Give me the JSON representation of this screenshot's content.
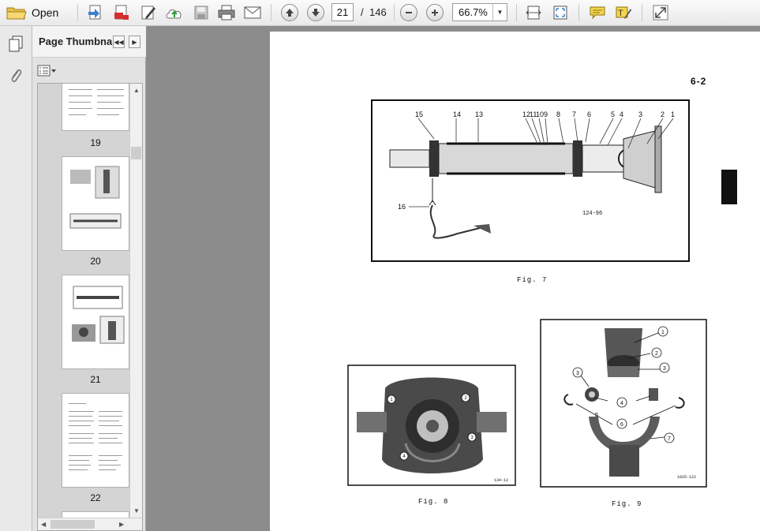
{
  "toolbar": {
    "open_label": "Open",
    "current_page": "21",
    "page_separator": "/",
    "total_pages": "146",
    "zoom_value": "66.7%"
  },
  "thumbnails_panel": {
    "title": "Page Thumbna...",
    "pages": [
      "19",
      "20",
      "21",
      "22"
    ]
  },
  "document_page": {
    "page_number": "6-2",
    "figures": [
      {
        "caption": "Fig. 7",
        "stamp": "124-96",
        "callouts": [
          "15",
          "14",
          "13",
          "12",
          "11",
          "10",
          "9",
          "8",
          "7",
          "6",
          "5",
          "4",
          "3",
          "2",
          "1",
          "16"
        ]
      },
      {
        "caption": "Fig. 8",
        "stamp": "134-12",
        "callouts": [
          "1",
          "2",
          "3",
          "4"
        ]
      },
      {
        "caption": "Fig. 9",
        "stamp": "1025-122",
        "callouts": [
          "1",
          "2",
          "3",
          "3",
          "4",
          "5",
          "6",
          "7"
        ]
      }
    ]
  }
}
